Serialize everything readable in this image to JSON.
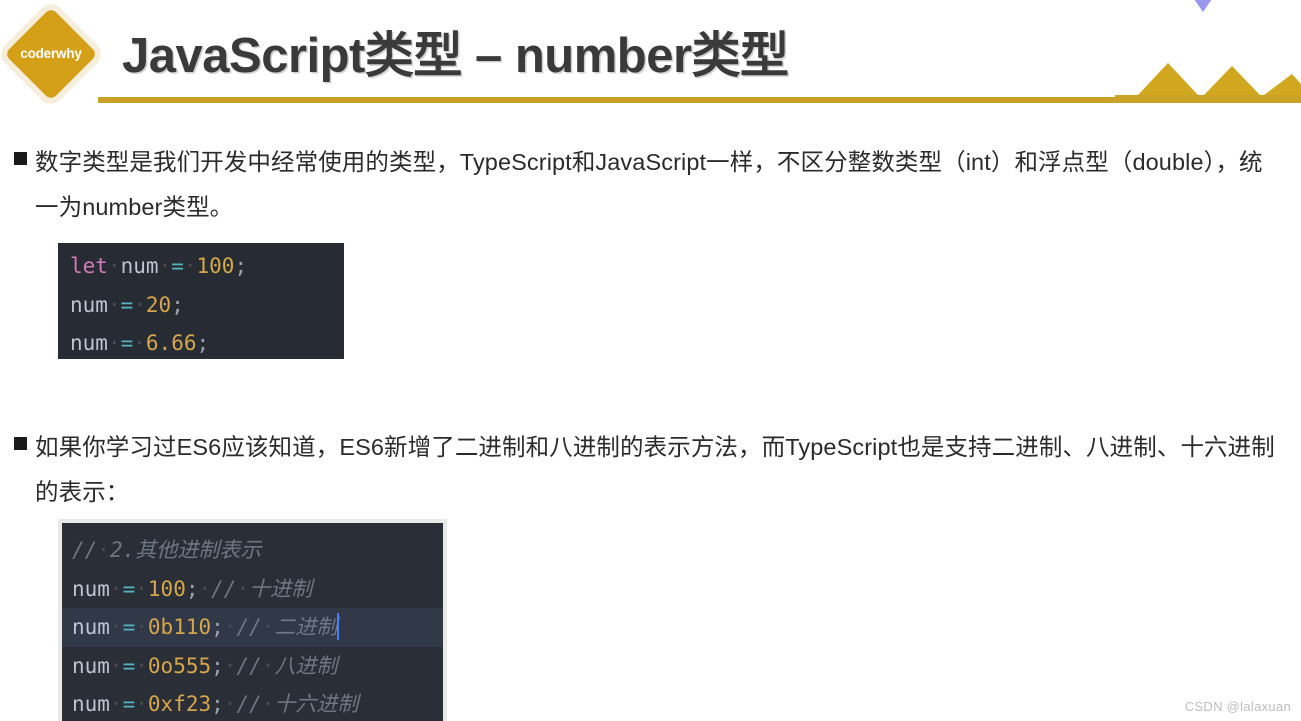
{
  "slide": {
    "logo_text": "coderwhy",
    "title": "JavaScript类型 – number类型",
    "accent_gold": "#C9A227",
    "logo_gold": "#D4A017",
    "purple": "#9A97EE",
    "background": "#FFFFFF"
  },
  "bullets": [
    {
      "marker": "square-bullet",
      "text": "数字类型是我们开发中经常使用的类型，TypeScript和JavaScript一样，不区分整数类型（int）和浮点型（double），统一为number类型。"
    },
    {
      "marker": "square-bullet",
      "text": "如果你学习过ES6应该知道，ES6新增了二进制和八进制的表示方法，而TypeScript也是支持二进制、八进制、十六进制的表示："
    }
  ],
  "code_blocks": [
    {
      "name": "number-assignment-snippet",
      "background": "#272B33",
      "lines": [
        {
          "highlighted": false,
          "tokens": [
            {
              "t": "let",
              "c": "kw"
            },
            {
              "t": "·",
              "c": "dot"
            },
            {
              "t": "num",
              "c": "var"
            },
            {
              "t": "·",
              "c": "dot"
            },
            {
              "t": "=",
              "c": "op"
            },
            {
              "t": "·",
              "c": "dot"
            },
            {
              "t": "100",
              "c": "num"
            },
            {
              "t": ";",
              "c": "punc"
            }
          ]
        },
        {
          "highlighted": false,
          "tokens": [
            {
              "t": "num",
              "c": "var"
            },
            {
              "t": "·",
              "c": "dot"
            },
            {
              "t": "=",
              "c": "op"
            },
            {
              "t": "·",
              "c": "dot"
            },
            {
              "t": "20",
              "c": "num"
            },
            {
              "t": ";",
              "c": "punc"
            }
          ]
        },
        {
          "highlighted": false,
          "tokens": [
            {
              "t": "num",
              "c": "var"
            },
            {
              "t": "·",
              "c": "dot"
            },
            {
              "t": "=",
              "c": "op"
            },
            {
              "t": "·",
              "c": "dot"
            },
            {
              "t": "6.66",
              "c": "num"
            },
            {
              "t": ";",
              "c": "punc"
            }
          ]
        }
      ]
    },
    {
      "name": "number-radix-snippet",
      "background": "#2A2E37",
      "lines": [
        {
          "highlighted": false,
          "tokens": [
            {
              "t": "//",
              "c": "comment"
            },
            {
              "t": "·",
              "c": "dot"
            },
            {
              "t": "2.其他进制表示",
              "c": "comment"
            }
          ]
        },
        {
          "highlighted": false,
          "tokens": [
            {
              "t": "num",
              "c": "var"
            },
            {
              "t": "·",
              "c": "dot"
            },
            {
              "t": "=",
              "c": "op"
            },
            {
              "t": "·",
              "c": "dot"
            },
            {
              "t": "100",
              "c": "num"
            },
            {
              "t": ";",
              "c": "punc"
            },
            {
              "t": "·",
              "c": "dot"
            },
            {
              "t": "//",
              "c": "comment"
            },
            {
              "t": "·",
              "c": "dot"
            },
            {
              "t": "十进制",
              "c": "comment"
            }
          ]
        },
        {
          "highlighted": true,
          "caret": true,
          "tokens": [
            {
              "t": "num",
              "c": "var"
            },
            {
              "t": "·",
              "c": "dot"
            },
            {
              "t": "=",
              "c": "op"
            },
            {
              "t": "·",
              "c": "dot"
            },
            {
              "t": "0b110",
              "c": "num"
            },
            {
              "t": ";",
              "c": "punc"
            },
            {
              "t": "·",
              "c": "dot"
            },
            {
              "t": "//",
              "c": "comment"
            },
            {
              "t": "·",
              "c": "dot"
            },
            {
              "t": "二进制",
              "c": "comment"
            }
          ]
        },
        {
          "highlighted": false,
          "tokens": [
            {
              "t": "num",
              "c": "var"
            },
            {
              "t": "·",
              "c": "dot"
            },
            {
              "t": "=",
              "c": "op"
            },
            {
              "t": "·",
              "c": "dot"
            },
            {
              "t": "0o555",
              "c": "num"
            },
            {
              "t": ";",
              "c": "punc"
            },
            {
              "t": "·",
              "c": "dot"
            },
            {
              "t": "//",
              "c": "comment"
            },
            {
              "t": "·",
              "c": "dot"
            },
            {
              "t": "八进制",
              "c": "comment"
            }
          ]
        },
        {
          "highlighted": false,
          "tokens": [
            {
              "t": "num",
              "c": "var"
            },
            {
              "t": "·",
              "c": "dot"
            },
            {
              "t": "=",
              "c": "op"
            },
            {
              "t": "·",
              "c": "dot"
            },
            {
              "t": "0xf23",
              "c": "num"
            },
            {
              "t": ";",
              "c": "punc"
            },
            {
              "t": "·",
              "c": "dot"
            },
            {
              "t": "//",
              "c": "comment"
            },
            {
              "t": "·",
              "c": "dot"
            },
            {
              "t": "十六进制",
              "c": "comment"
            }
          ]
        }
      ]
    }
  ],
  "watermark": "CSDN @lalaxuan"
}
